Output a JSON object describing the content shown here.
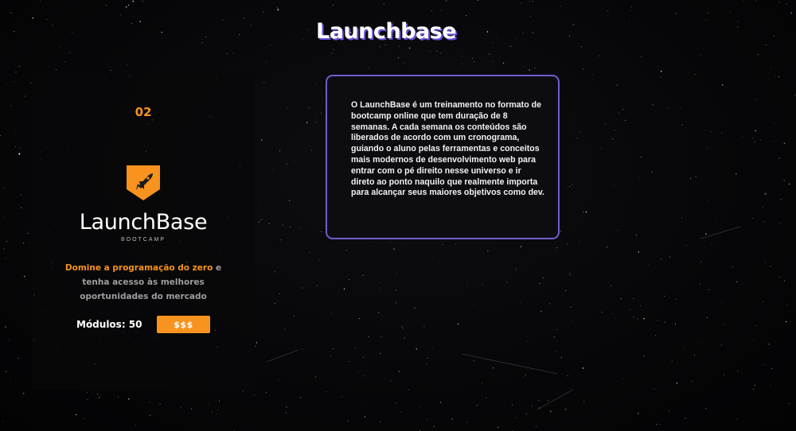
{
  "header": {
    "title": "Launchbase"
  },
  "card": {
    "number": "02",
    "logo_icon": "rocket-shield-icon",
    "brand_name": "LaunchBase",
    "brand_sub": "BOOTCAMP",
    "desc_highlight": "Domine a programação do zero",
    "desc_rest": " e tenha acesso às melhores oportunidades do mercado",
    "modules_label": "Módulos: 50",
    "price_label": "$$$"
  },
  "info": {
    "text": "O LaunchBase é um treinamento no formato de bootcamp online que tem duração de 8 semanas. A cada semana os conteúdos são liberados de acordo com um cronograma, guiando o aluno pelas ferramentas e conceitos mais modernos de desenvolvimento web para entrar com o pé direito nesse universo e ir direto ao ponto naquilo que realmente importa para alcançar seus maiores objetivos como dev."
  },
  "colors": {
    "accent": "#f7931e",
    "border": "#6f5dcf",
    "background": "#050507"
  }
}
